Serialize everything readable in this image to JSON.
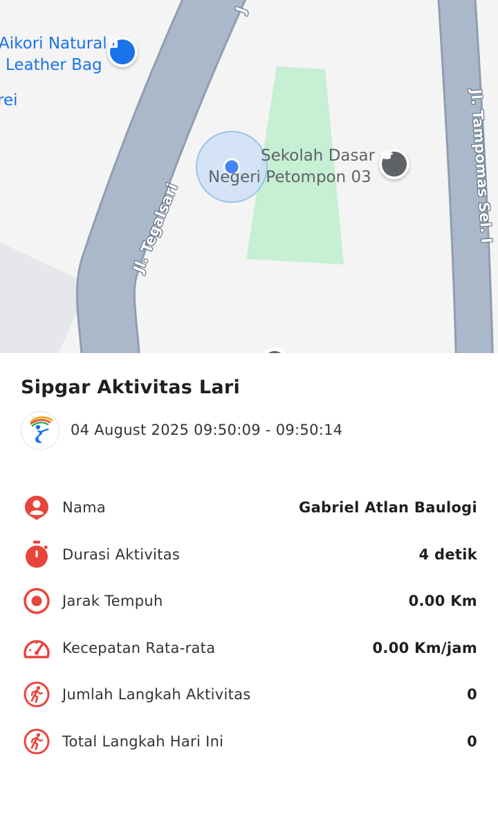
{
  "map": {
    "poi_bag_line1": "Aikori Natural",
    "poi_bag_line2": "Leather Bag",
    "poi_partial_line1": "rei",
    "poi_partial_line2": "i",
    "poi_school_line1": "Sekolah Dasar",
    "poi_school_line2": "Negeri Petompon 03",
    "road_tegalsari": "Jl. Tegalsari",
    "road_tampomas": "Jl. Tampomas Sel. I",
    "road_top": "J"
  },
  "activity": {
    "title": "Sipgar Aktivitas Lari",
    "datetime": "04 August 2025 09:50:09 - 09:50:14"
  },
  "stats": [
    {
      "icon": "person-pin-icon",
      "label": "Nama",
      "value": "Gabriel Atlan Baulogi"
    },
    {
      "icon": "stopwatch-icon",
      "label": "Durasi Aktivitas",
      "value": "4 detik"
    },
    {
      "icon": "target-icon",
      "label": "Jarak Tempuh",
      "value": "0.00 Km"
    },
    {
      "icon": "speedometer-icon",
      "label": "Kecepatan Rata-rata",
      "value": "0.00 Km/jam"
    },
    {
      "icon": "running-icon",
      "label": "Jumlah Langkah Aktivitas",
      "value": "0"
    },
    {
      "icon": "running-icon",
      "label": "Total Langkah Hari Ini",
      "value": "0"
    }
  ],
  "colors": {
    "accent_red": "#e8453c",
    "map_blue": "#1a73e8",
    "road": "#aab8ca",
    "park": "#c6efd4"
  }
}
